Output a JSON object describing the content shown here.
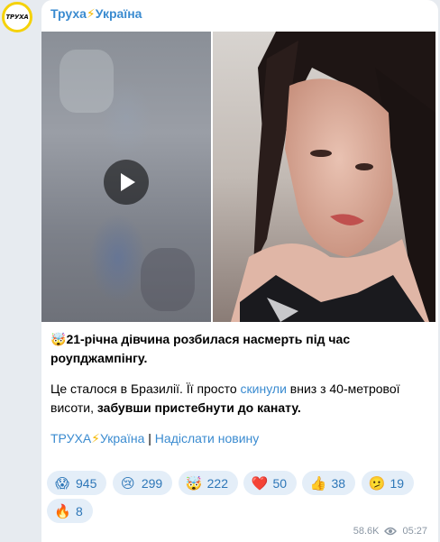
{
  "channel": {
    "avatar_text": "ТРУХА",
    "name_part1": "Труха",
    "bolt": "⚡",
    "name_part2": "Україна"
  },
  "post": {
    "headline_emoji": "🤯",
    "headline": "21-річна дівчина розбилася насмерть під час роупджампінгу.",
    "body_part1": "Це сталося в Бразилії. Її просто ",
    "body_link": "скинули",
    "body_part2": " вниз з 40-метрової висоти, ",
    "body_bold": "забувши пристебнути до канату.",
    "footer_name1": "ТРУХА",
    "footer_bolt": "⚡",
    "footer_name2": "Україна",
    "footer_sep": " | ",
    "footer_link": "Надіслати новину"
  },
  "reactions": [
    {
      "emoji": "😱",
      "count": "945"
    },
    {
      "emoji": "😢",
      "count": "299"
    },
    {
      "emoji": "🤯",
      "count": "222"
    },
    {
      "emoji": "❤️",
      "count": "50"
    },
    {
      "emoji": "👍",
      "count": "38"
    },
    {
      "emoji": "🫤",
      "count": "19"
    },
    {
      "emoji": "🔥",
      "count": "8"
    }
  ],
  "meta": {
    "views": "58.6K",
    "time": "05:27"
  },
  "icons": {
    "play": "play-icon",
    "views": "eye-icon"
  }
}
